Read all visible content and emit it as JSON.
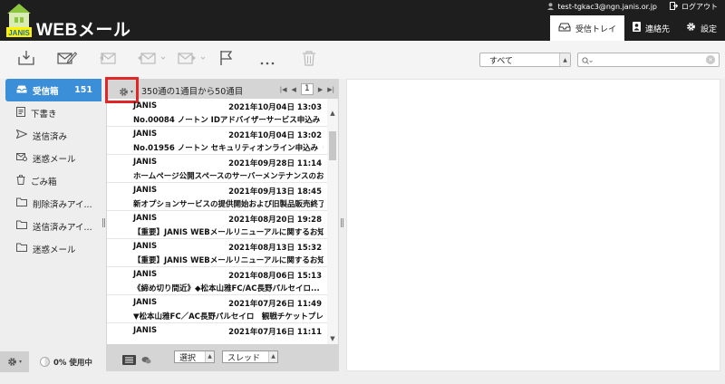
{
  "header": {
    "app_title": "WEBメール",
    "logo_text": "JANIS",
    "user_email": "test-tgkac3@ngn.janis.or.jp",
    "logout_label": "ログアウト",
    "nav": [
      {
        "label": "受信トレイ",
        "icon": "inbox-icon",
        "active": true
      },
      {
        "label": "連絡先",
        "icon": "contacts-icon",
        "active": false
      },
      {
        "label": "設定",
        "icon": "gear-icon",
        "active": false
      }
    ]
  },
  "toolbar": {
    "icons": [
      "check-mail-icon",
      "compose-icon",
      "reply-icon",
      "reply-all-icon",
      "forward-icon",
      "flag-icon",
      "more-icon",
      "delete-icon"
    ],
    "filter_value": "すべて",
    "search_placeholder": ""
  },
  "sidebar": {
    "folders": [
      {
        "label": "受信箱",
        "count": "151",
        "icon": "inbox-icon",
        "active": true
      },
      {
        "label": "下書き",
        "count": "",
        "icon": "draft-icon",
        "active": false
      },
      {
        "label": "送信済み",
        "count": "",
        "icon": "sent-icon",
        "active": false
      },
      {
        "label": "迷惑メール",
        "count": "",
        "icon": "spam-icon",
        "active": false
      },
      {
        "label": "ごみ箱",
        "count": "",
        "icon": "trash-icon",
        "active": false
      },
      {
        "label": "削除済みアイ...",
        "count": "",
        "icon": "folder-icon",
        "active": false
      },
      {
        "label": "送信済みアイ...",
        "count": "",
        "icon": "folder-icon",
        "active": false
      },
      {
        "label": "迷惑メール",
        "count": "",
        "icon": "folder-icon",
        "active": false
      }
    ],
    "usage_label": "0% 使用中"
  },
  "list": {
    "info": "350通の1通目から50通目",
    "page": "1",
    "messages": [
      {
        "from": "JANIS",
        "date": "2021年10月04日 13:03",
        "subject": "No.00084 ノートン IDアドバイザーサービス申込み（..."
      },
      {
        "from": "JANIS",
        "date": "2021年10月04日 13:02",
        "subject": "No.01956 ノートン セキュリティオンライン申込み（..."
      },
      {
        "from": "JANIS",
        "date": "2021年09月28日 11:14",
        "subject": "ホームページ公開スペースのサーバーメンテナンスのお..."
      },
      {
        "from": "JANIS",
        "date": "2021年09月13日 18:45",
        "subject": "新オプションサービスの提供開始および旧製品販売終了..."
      },
      {
        "from": "JANIS",
        "date": "2021年08月20日 19:28",
        "subject": "【重要】JANIS WEBメールリニューアルに関するお知..."
      },
      {
        "from": "JANIS",
        "date": "2021年08月13日 15:32",
        "subject": "【重要】JANIS WEBメールリニューアルに関するお知..."
      },
      {
        "from": "JANIS",
        "date": "2021年08月06日 15:13",
        "subject": "《締め切り間近》◆松本山雅FC/AC長野パルセイロ..."
      },
      {
        "from": "JANIS",
        "date": "2021年07月26日 11:49",
        "subject": "▼松本山雅FC／AC長野パルセイロ　観戦チケットプレ..."
      },
      {
        "from": "JANIS",
        "date": "2021年07月16日 11:11",
        "subject": ""
      }
    ],
    "footer": {
      "select_label": "選択",
      "thread_label": "スレッド"
    }
  }
}
